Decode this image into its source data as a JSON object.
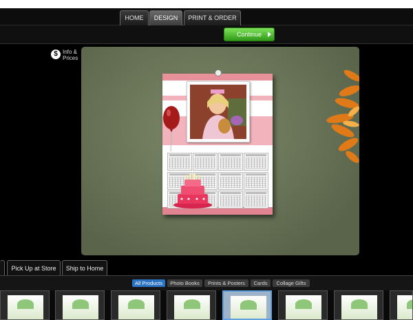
{
  "tabs": [
    {
      "label": "HOME",
      "active": false
    },
    {
      "label": "DESIGN",
      "active": true
    },
    {
      "label": "PRINT & ORDER",
      "active": false
    }
  ],
  "actions": {
    "continue_label": "Continue"
  },
  "info": {
    "icon": "dollar-icon",
    "line1": "Info &",
    "line2": "Prices"
  },
  "delivery_tabs": [
    {
      "label": "Pick Up at Store"
    },
    {
      "label": "Ship to Home"
    }
  ],
  "categories": [
    {
      "label": "All Products",
      "active": true
    },
    {
      "label": "Photo Books",
      "active": false
    },
    {
      "label": "Prints & Posters",
      "active": false
    },
    {
      "label": "Cards",
      "active": false
    },
    {
      "label": "Collage Gifts",
      "active": false
    }
  ],
  "colors": {
    "accent": "#2b74c4",
    "continue": "#3fb320",
    "stage": "#6f7a5c",
    "calendar_pink": "#f3b3bc"
  }
}
